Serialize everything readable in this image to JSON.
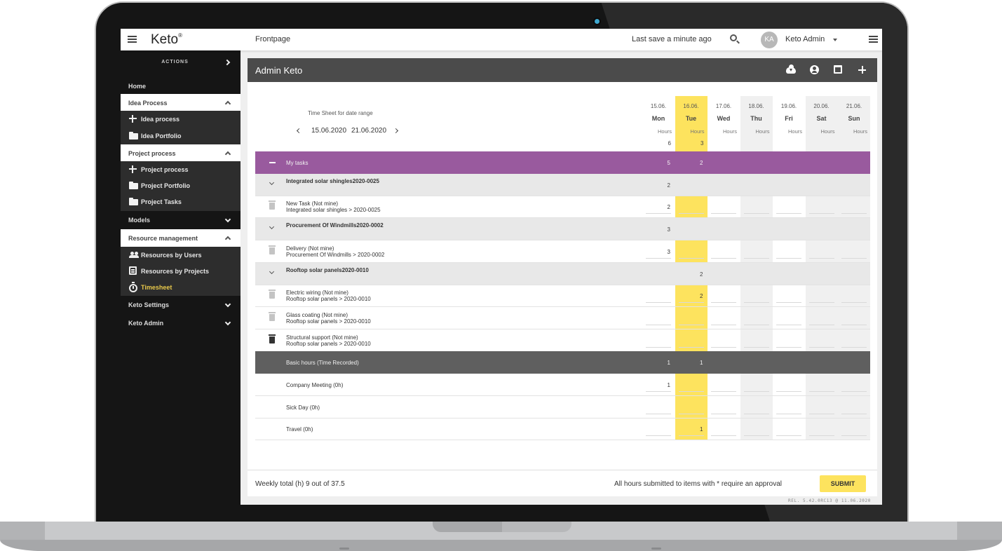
{
  "topbar": {
    "logo": "Keto",
    "logo_mark": "®",
    "breadcrumb": "Frontpage",
    "last_save": "Last save a minute ago",
    "avatar_initials": "KA",
    "user_name": "Keto Admin"
  },
  "sidebar": {
    "actions_label": "ACTIONS",
    "home": "Home",
    "sections": [
      {
        "label": "Idea Process",
        "expanded": true,
        "items": [
          {
            "label": "Idea process",
            "icon": "plus-icon"
          },
          {
            "label": "Idea Portfolio",
            "icon": "folder-icon"
          }
        ]
      },
      {
        "label": "Project process",
        "expanded": true,
        "items": [
          {
            "label": "Project process",
            "icon": "plus-icon"
          },
          {
            "label": "Project Portfolio",
            "icon": "folder-icon"
          },
          {
            "label": "Project Tasks",
            "icon": "folder-icon"
          }
        ]
      },
      {
        "label": "Models",
        "expanded": false,
        "items": []
      },
      {
        "label": "Resource management",
        "expanded": true,
        "items": [
          {
            "label": "Resources by Users",
            "icon": "people-icon"
          },
          {
            "label": "Resources by Projects",
            "icon": "calendar-list-icon"
          },
          {
            "label": "Timesheet",
            "icon": "timer-icon",
            "active": true
          }
        ]
      },
      {
        "label": "Keto Settings",
        "expanded": false,
        "items": []
      },
      {
        "label": "Keto Admin",
        "expanded": false,
        "items": []
      }
    ]
  },
  "panel": {
    "title": "Admin Keto",
    "actions": [
      "cloud-download-icon",
      "account-icon",
      "calendar-icon",
      "plus-icon"
    ]
  },
  "timesheet": {
    "range_label": "Time Sheet for date range",
    "range_start": "15.06.2020",
    "range_end": "21.06.2020",
    "hours_label": "Hours",
    "days": [
      {
        "date": "15.06.",
        "weekday": "Mon",
        "total": "6",
        "style": "normal"
      },
      {
        "date": "16.06.",
        "weekday": "Tue",
        "total": "3",
        "style": "today"
      },
      {
        "date": "17.06.",
        "weekday": "Wed",
        "total": "",
        "style": "normal"
      },
      {
        "date": "18.06.",
        "weekday": "Thu",
        "total": "",
        "style": "shaded"
      },
      {
        "date": "19.06.",
        "weekday": "Fri",
        "total": "",
        "style": "normal"
      },
      {
        "date": "20.06.",
        "weekday": "Sat",
        "total": "",
        "style": "shaded"
      },
      {
        "date": "21.06.",
        "weekday": "Sun",
        "total": "",
        "style": "shaded"
      }
    ],
    "rows": [
      {
        "type": "section",
        "name": "My tasks",
        "values": [
          "5",
          "2",
          "",
          "",
          "",
          "",
          ""
        ]
      },
      {
        "type": "group",
        "name": "Integrated solar shingles2020-0025",
        "values": [
          "2",
          "",
          "",
          "",
          "",
          "",
          ""
        ]
      },
      {
        "type": "task",
        "name": "New Task (Not mine)",
        "sub": "Integrated solar shingles > 2020-0025",
        "trash": "light",
        "values": [
          "2",
          "",
          "",
          "",
          "",
          "",
          ""
        ]
      },
      {
        "type": "group",
        "name": "Procurement Of Windmills2020-0002",
        "values": [
          "3",
          "",
          "",
          "",
          "",
          "",
          ""
        ]
      },
      {
        "type": "task",
        "name": "Delivery (Not mine)",
        "sub": "Procurement Of Windmills > 2020-0002",
        "trash": "light",
        "values": [
          "3",
          "",
          "",
          "",
          "",
          "",
          ""
        ]
      },
      {
        "type": "group",
        "name": "Rooftop solar panels2020-0010",
        "values": [
          "",
          "2",
          "",
          "",
          "",
          "",
          ""
        ]
      },
      {
        "type": "task",
        "name": "Electric wiring (Not mine)",
        "sub": "Rooftop solar panels > 2020-0010",
        "trash": "light",
        "values": [
          "",
          "2",
          "",
          "",
          "",
          "",
          ""
        ]
      },
      {
        "type": "task",
        "name": "Glass coating (Not mine)",
        "sub": "Rooftop solar panels > 2020-0010",
        "trash": "light",
        "values": [
          "",
          "",
          "",
          "",
          "",
          "",
          ""
        ]
      },
      {
        "type": "task",
        "name": "Structural support (Not mine)",
        "sub": "Rooftop solar panels > 2020-0010",
        "trash": "dark",
        "values": [
          "",
          "",
          "",
          "",
          "",
          "",
          ""
        ]
      },
      {
        "type": "basic",
        "name": "Basic hours (Time Recorded)",
        "values": [
          "1",
          "1",
          "",
          "",
          "",
          "",
          ""
        ]
      },
      {
        "type": "item",
        "name": "Company Meeting (0h)",
        "values": [
          "1",
          "",
          "",
          "",
          "",
          "",
          ""
        ]
      },
      {
        "type": "item",
        "name": "Sick Day (0h)",
        "values": [
          "",
          "",
          "",
          "",
          "",
          "",
          ""
        ]
      },
      {
        "type": "item",
        "name": "Travel (0h)",
        "values": [
          "",
          "1",
          "",
          "",
          "",
          "",
          ""
        ]
      }
    ]
  },
  "footer": {
    "weekly_total": "Weekly total (h) 9  out of 37.5",
    "approval_note": "All hours submitted to items with * require an approval",
    "submit_label": "SUBMIT",
    "release": "REL. 5.42.0RC13 @ 11.06.2020"
  },
  "colors": {
    "accent_yellow": "#fde35e",
    "section_purple": "#995a9e",
    "header_dark": "#4b4b4b",
    "basic_row": "#5f5f5f",
    "shaded_day": "#f0f0f0",
    "active_sidebar": "#e8c84a"
  }
}
